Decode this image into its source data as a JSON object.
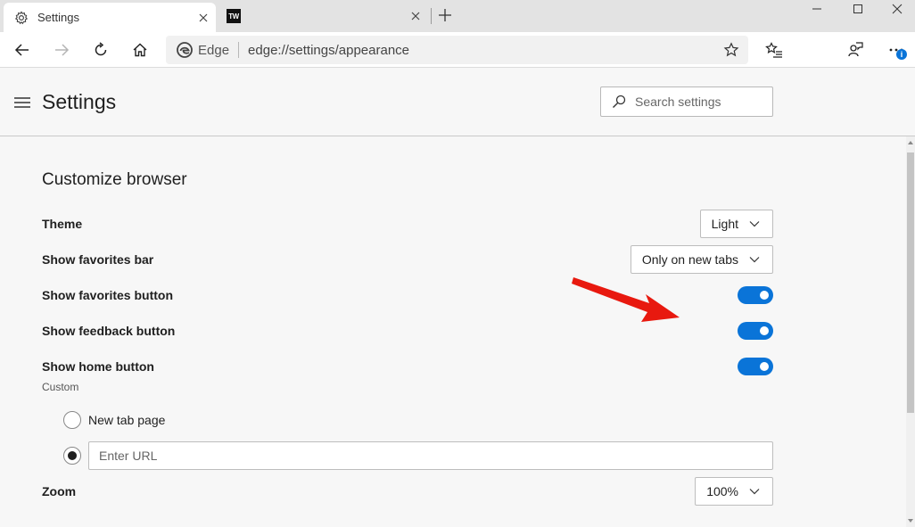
{
  "tabs": [
    {
      "label": "Settings",
      "icon": "gear-icon",
      "active": true
    },
    {
      "label": "",
      "icon": "tw-favicon",
      "favicon_text": "TW",
      "active": false
    }
  ],
  "address_bar": {
    "brand": "Edge",
    "url": "edge://settings/appearance"
  },
  "header": {
    "title": "Settings",
    "search_placeholder": "Search settings"
  },
  "section": {
    "title": "Customize browser",
    "theme": {
      "label": "Theme",
      "value": "Light"
    },
    "favorites_bar": {
      "label": "Show favorites bar",
      "value": "Only on new tabs"
    },
    "favorites_button": {
      "label": "Show favorites button",
      "on": true
    },
    "feedback_button": {
      "label": "Show feedback button",
      "on": true
    },
    "home_button": {
      "label": "Show home button",
      "on": true,
      "sublabel": "Custom"
    },
    "home_options": {
      "new_tab_label": "New tab page",
      "url_placeholder": "Enter URL",
      "selected": "url"
    },
    "zoom": {
      "label": "Zoom",
      "value": "100%"
    }
  },
  "colors": {
    "accent": "#0a74d8",
    "arrow": "#e8190f"
  }
}
